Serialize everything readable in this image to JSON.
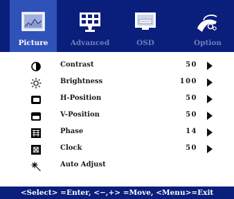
{
  "tabs": [
    {
      "label": "Picture",
      "icon": "picture-icon",
      "active": true
    },
    {
      "label": "Advanced",
      "icon": "advanced-icon",
      "active": false
    },
    {
      "label": "OSD",
      "icon": "osd-icon",
      "active": false
    },
    {
      "label": "Option",
      "icon": "option-icon",
      "active": false
    }
  ],
  "items": [
    {
      "label": "Contrast",
      "value": "50",
      "icon": "contrast-icon"
    },
    {
      "label": "Brightness",
      "value": "100",
      "icon": "brightness-icon"
    },
    {
      "label": "H-Position",
      "value": "50",
      "icon": "h-position-icon"
    },
    {
      "label": "V-Position",
      "value": "50",
      "icon": "v-position-icon"
    },
    {
      "label": "Phase",
      "value": "14",
      "icon": "phase-icon"
    },
    {
      "label": "Clock",
      "value": "50",
      "icon": "clock-icon"
    },
    {
      "label": "Auto Adjust",
      "value": "",
      "icon": "auto-adjust-icon"
    }
  ],
  "footer": {
    "text": "<Select> =Enter, <−,+> =Move, <Menu>=Exit"
  },
  "colors": {
    "header_bg": "#0a1e7c",
    "active_tab": "#2f52b8",
    "inactive_label": "#6f7fb8"
  }
}
